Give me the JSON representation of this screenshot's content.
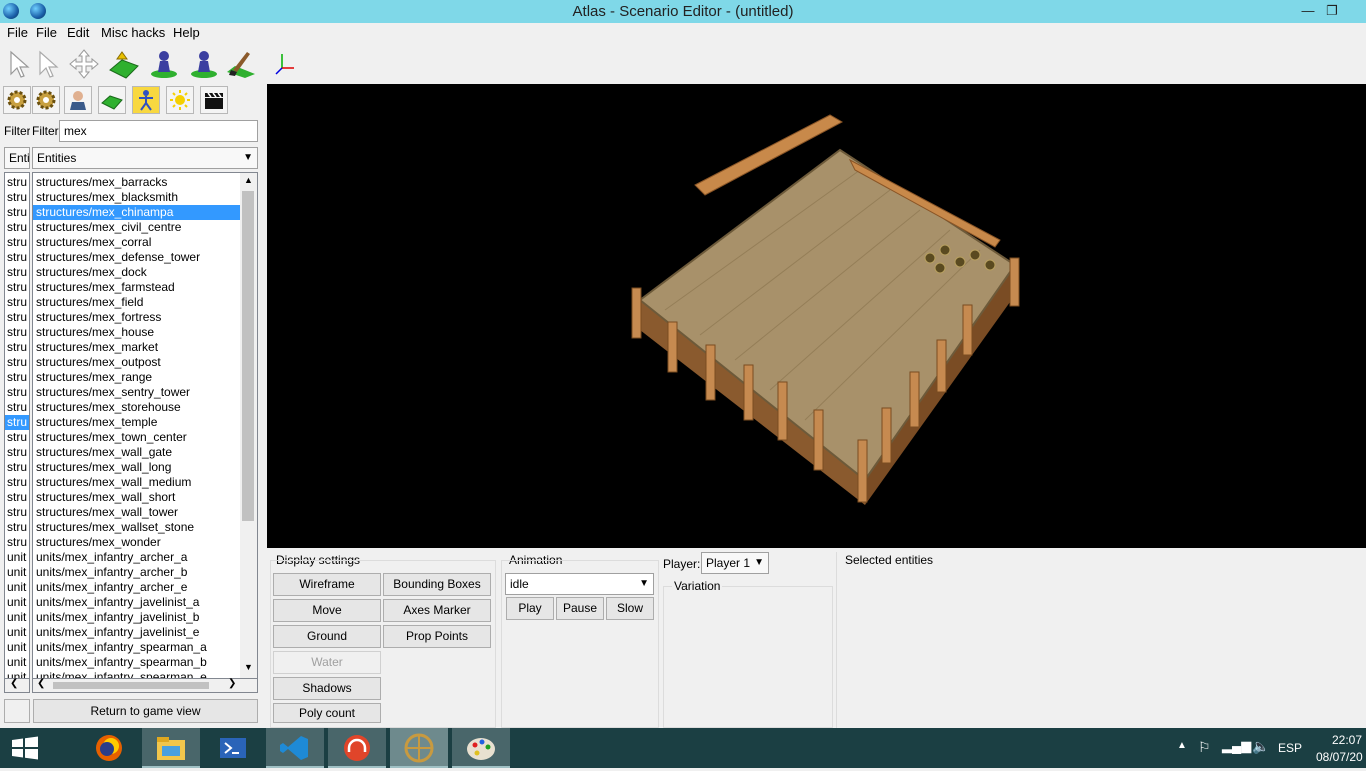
{
  "window": {
    "title": "Atlas - Scenario Editor - (untitled)"
  },
  "menu": [
    "File",
    "File",
    "Edit",
    "Misc hacks",
    "Help"
  ],
  "filter": {
    "label": "Filter",
    "label_clipped": "Filter",
    "value": "mex"
  },
  "type_select": {
    "clipped": "Enti",
    "value": "Entities"
  },
  "list_prefixes": [
    "stru",
    "stru",
    "stru",
    "stru",
    "stru",
    "stru",
    "stru",
    "stru",
    "stru",
    "stru",
    "stru",
    "stru",
    "stru",
    "stru",
    "stru",
    "stru",
    "stru",
    "stru",
    "stru",
    "stru",
    "stru",
    "stru",
    "stru",
    "stru",
    "stru",
    "unit",
    "unit",
    "unit",
    "unit",
    "unit",
    "unit",
    "unit",
    "unit",
    "unit"
  ],
  "entities": [
    "structures/mex_barracks",
    "structures/mex_blacksmith",
    "structures/mex_chinampa",
    "structures/mex_civil_centre",
    "structures/mex_corral",
    "structures/mex_defense_tower",
    "structures/mex_dock",
    "structures/mex_farmstead",
    "structures/mex_field",
    "structures/mex_fortress",
    "structures/mex_house",
    "structures/mex_market",
    "structures/mex_outpost",
    "structures/mex_range",
    "structures/mex_sentry_tower",
    "structures/mex_storehouse",
    "structures/mex_temple",
    "structures/mex_town_center",
    "structures/mex_wall_gate",
    "structures/mex_wall_long",
    "structures/mex_wall_medium",
    "structures/mex_wall_short",
    "structures/mex_wall_tower",
    "structures/mex_wallset_stone",
    "structures/mex_wonder",
    "units/mex_infantry_archer_a",
    "units/mex_infantry_archer_b",
    "units/mex_infantry_archer_e",
    "units/mex_infantry_javelinist_a",
    "units/mex_infantry_javelinist_b",
    "units/mex_infantry_javelinist_e",
    "units/mex_infantry_spearman_a",
    "units/mex_infantry_spearman_b",
    "units/mex_infantry_spearman_e"
  ],
  "return_button": "Return to game view",
  "display_settings": {
    "title": "Display settings",
    "wireframe": "Wireframe",
    "bounding_boxes": "Bounding Boxes",
    "move": "Move",
    "axes_marker": "Axes Marker",
    "ground": "Ground",
    "prop_points": "Prop Points",
    "water": "Water",
    "shadows": "Shadows",
    "poly_count": "Poly count"
  },
  "animation": {
    "title": "Animation",
    "selected": "idle",
    "play": "Play",
    "pause": "Pause",
    "slow": "Slow"
  },
  "player": {
    "label": "Player:",
    "selected": "Player 1"
  },
  "variation": {
    "title": "Variation"
  },
  "selected_entities": {
    "title": "Selected entities"
  },
  "tray": {
    "lang": "ESP",
    "time": "22:07",
    "date": "08/07/20"
  },
  "colors": {
    "titlebar": "#7fd8e8",
    "selection": "#3399ff",
    "taskbar": "#1b3f43",
    "viewport": "#000000"
  }
}
